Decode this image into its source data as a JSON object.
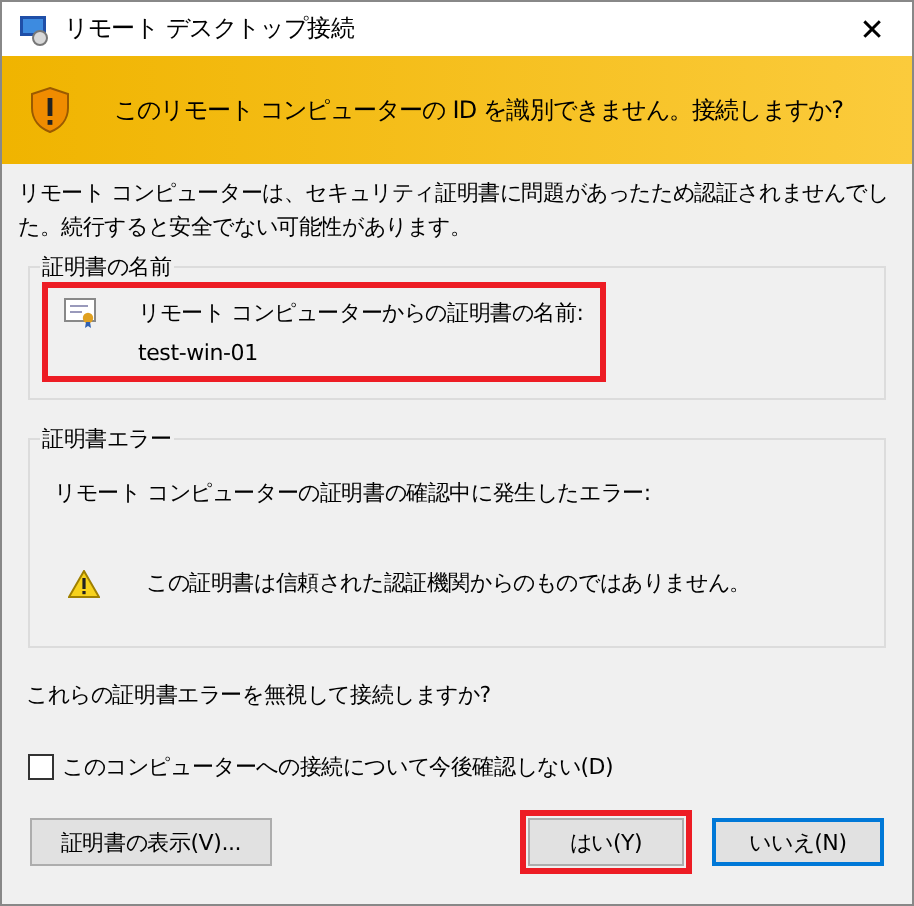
{
  "window": {
    "title": "リモート デスクトップ接続",
    "close": "✕"
  },
  "banner": {
    "message": "このリモート コンピューターの ID を識別できません。接続しますか?"
  },
  "description": "リモート コンピューターは、セキュリティ証明書に問題があったため認証されませんでした。続行すると安全でない可能性があります。",
  "certificate_name_group": {
    "title": "証明書の名前",
    "label": "リモート コンピューターからの証明書の名前:",
    "value": "test-win-01",
    "highlighted": true
  },
  "certificate_error_group": {
    "title": "証明書エラー",
    "intro": "リモート コンピューターの証明書の確認中に発生したエラー:",
    "errors": [
      "この証明書は信頼された認証機関からのものではありません。"
    ]
  },
  "question": "これらの証明書エラーを無視して接続しますか?",
  "checkbox": {
    "label": "このコンピューターへの接続について今後確認しない(D)",
    "checked": false
  },
  "buttons": [
    {
      "label": "証明書の表示(V)...",
      "kind": "view",
      "highlighted": false,
      "focused": false
    },
    {
      "label": "はい(Y)",
      "kind": "yes",
      "highlighted": true,
      "focused": false
    },
    {
      "label": "いいえ(N)",
      "kind": "no",
      "highlighted": false,
      "focused": true
    }
  ]
}
